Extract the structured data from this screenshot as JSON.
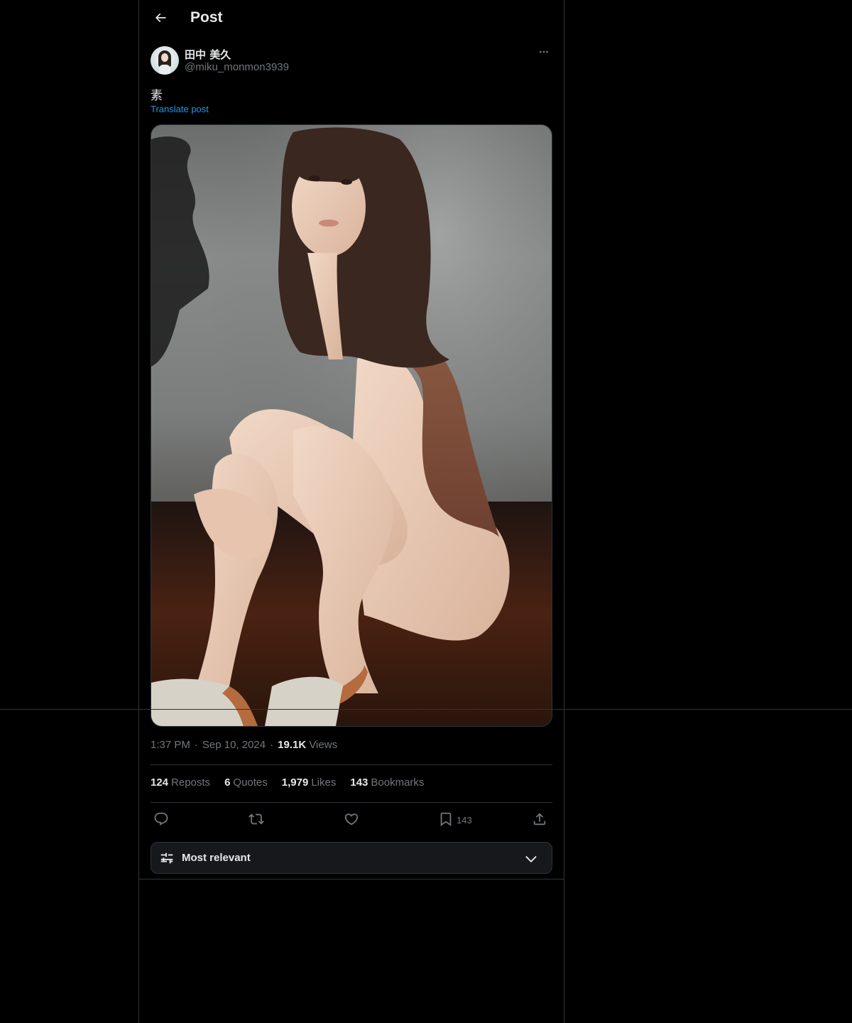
{
  "header": {
    "title": "Post",
    "back_icon": "arrow-left-icon"
  },
  "author": {
    "display_name": "田中 美久",
    "handle": "@miku_monmon3939",
    "more_icon": "more-horizontal-icon"
  },
  "post": {
    "text": "素",
    "translate_label": "Translate post",
    "media_alt": "photo"
  },
  "meta": {
    "time": "1:37 PM",
    "separator": "·",
    "date": "Sep 10, 2024",
    "views_count": "19.1K",
    "views_label": "Views"
  },
  "stats": [
    {
      "count": "124",
      "label": "Reposts"
    },
    {
      "count": "6",
      "label": "Quotes"
    },
    {
      "count": "1,979",
      "label": "Likes"
    },
    {
      "count": "143",
      "label": "Bookmarks"
    }
  ],
  "actions": {
    "reply_icon": "reply-icon",
    "repost_icon": "repost-icon",
    "like_icon": "heart-icon",
    "bookmark_icon": "bookmark-icon",
    "bookmark_count": "143",
    "share_icon": "share-icon"
  },
  "sort": {
    "label": "Most relevant",
    "icon": "sliders-icon",
    "chevron": "chevron-down-icon"
  },
  "colors": {
    "background": "#000000",
    "text": "#e7e9ea",
    "muted": "#71767b",
    "accent": "#1d9bf0",
    "border": "#2f3336"
  }
}
